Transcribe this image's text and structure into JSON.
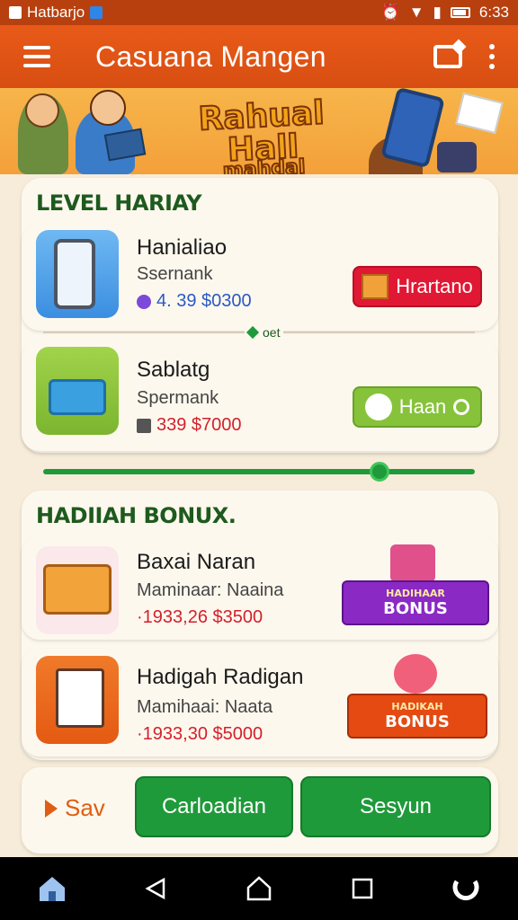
{
  "status_bar": {
    "carrier": "Hatbarjo",
    "time": "6:33"
  },
  "app_bar": {
    "title": "Casuana Mangen"
  },
  "banner": {
    "line1": "Rahual Hall",
    "line2": "mahdal"
  },
  "level_section": {
    "title": "LEVEL HARIAY",
    "divider_label": "oet",
    "items": [
      {
        "title": "Hanialiao",
        "subtitle": "Ssernank",
        "price": "4. 39 $0300",
        "button_label": "Hrartano"
      },
      {
        "title": "Sablatg",
        "subtitle": "Spermank",
        "price": "339 $7000",
        "button_label": "Haan"
      }
    ],
    "progress": 0.78
  },
  "bonus_section": {
    "title": "HADIIAH BONUX.",
    "items": [
      {
        "title": "Baxai Naran",
        "subtitle": "Maminaar: Naaina",
        "price": "·1933,26 $3500",
        "badge_small": "HADIHAAR",
        "badge_big": "BONUS"
      },
      {
        "title": "Hadigah Radigan",
        "subtitle": "Mamihaai: Naata",
        "price": "·1933,30 $5000",
        "badge_small": "HADIKAH",
        "badge_big": "BONUS"
      }
    ]
  },
  "actions": {
    "save_label": "Sav",
    "cancel_label": "Carloadian",
    "confirm_label": "Sesyun"
  },
  "colors": {
    "primary": "#e85a18",
    "green": "#1f9a3a",
    "red": "#e01834",
    "purple": "#8a29c4"
  }
}
